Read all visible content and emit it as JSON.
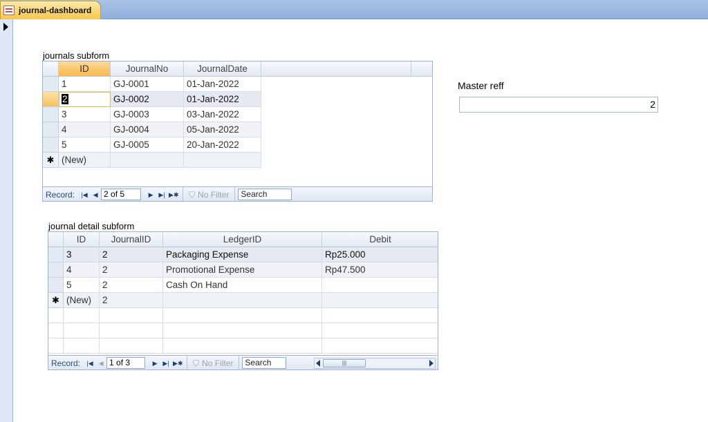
{
  "tab": {
    "title": "journal-dashboard"
  },
  "journals": {
    "label": "journals subform",
    "columns": [
      "ID",
      "JournalNo",
      "JournalDate"
    ],
    "rows": [
      [
        "1",
        "GJ-0001",
        "01-Jan-2022"
      ],
      [
        "2",
        "GJ-0002",
        "01-Jan-2022"
      ],
      [
        "3",
        "GJ-0003",
        "03-Jan-2022"
      ],
      [
        "4",
        "GJ-0004",
        "05-Jan-2022"
      ],
      [
        "5",
        "GJ-0005",
        "20-Jan-2022"
      ]
    ],
    "new_row": "(New)",
    "new_marker": "✱",
    "nav": {
      "record_label": "Record:",
      "position": "2 of 5",
      "filter_label": "No Filter",
      "search_placeholder": "Search"
    }
  },
  "details": {
    "label": "journal  detail subform",
    "columns": [
      "ID",
      "JournalID",
      "LedgerID",
      "Debit"
    ],
    "rows": [
      [
        "3",
        "2",
        "Packaging Expense",
        "Rp25.000"
      ],
      [
        "4",
        "2",
        "Promotional Expense",
        "Rp47.500"
      ],
      [
        "5",
        "2",
        "Cash On Hand",
        ""
      ]
    ],
    "new_row": [
      "(New)",
      "2"
    ],
    "new_marker": "✱",
    "nav": {
      "record_label": "Record:",
      "position": "1 of 3",
      "filter_label": "No Filter",
      "search_placeholder": "Search"
    }
  },
  "master": {
    "label": "Master reff",
    "value": "2"
  }
}
